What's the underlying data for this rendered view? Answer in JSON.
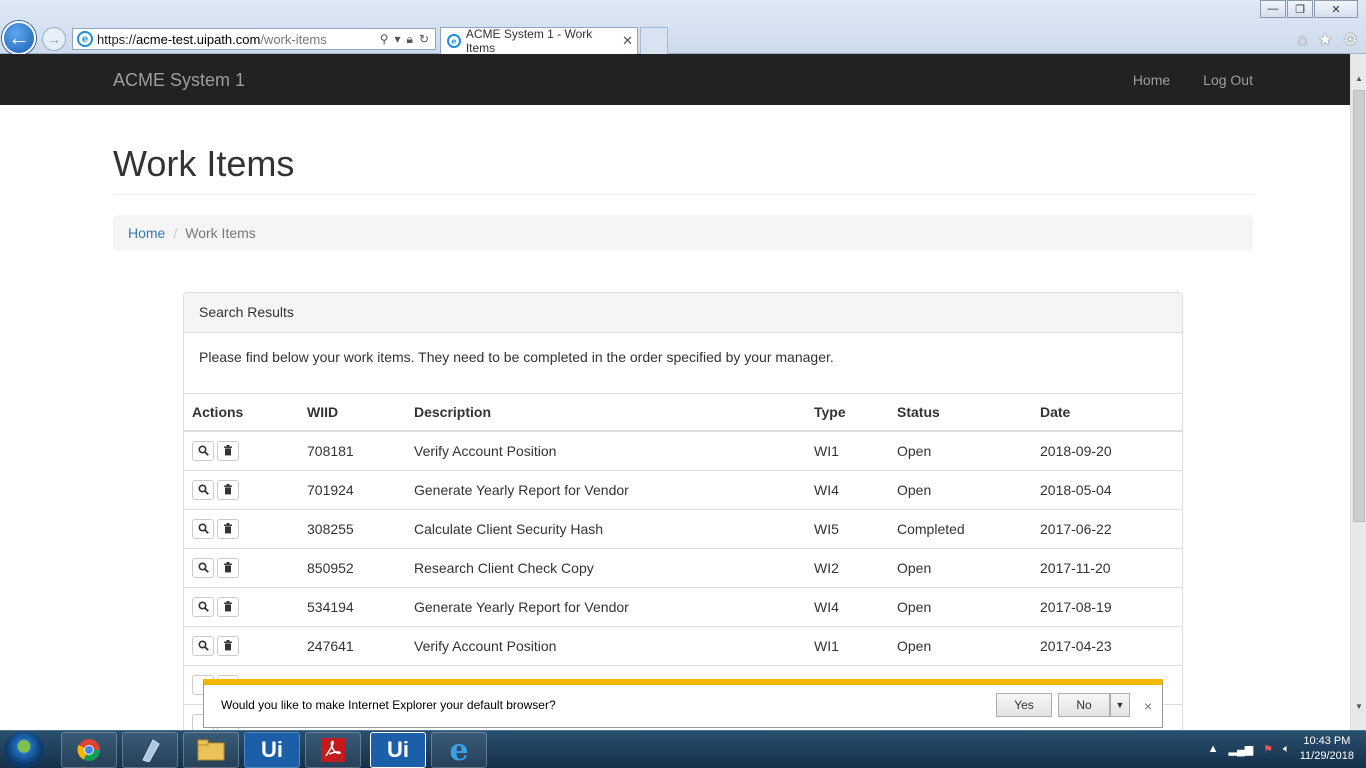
{
  "browser": {
    "url_prefix": "https://",
    "url_host": "acme-test.uipath.com",
    "url_path": "/work-items",
    "tab_title": "ACME System 1 - Work Items",
    "tab_close": "✕",
    "win_minimize": "—",
    "win_restore": "❐",
    "win_close": "✕"
  },
  "navbar": {
    "brand": "ACME System 1",
    "links": [
      "Home",
      "Log Out"
    ]
  },
  "page": {
    "title": "Work Items",
    "breadcrumb": [
      "Home",
      "Work Items"
    ],
    "breadcrumb_sep": "/"
  },
  "panel": {
    "heading": "Search Results",
    "body": "Please find below your work items. They need to be completed in the order specified by your manager.",
    "columns": [
      "Actions",
      "WIID",
      "Description",
      "Type",
      "Status",
      "Date"
    ],
    "rows": [
      {
        "wiid": "708181",
        "description": "Verify Account Position",
        "type": "WI1",
        "status": "Open",
        "date": "2018-09-20"
      },
      {
        "wiid": "701924",
        "description": "Generate Yearly Report for Vendor",
        "type": "WI4",
        "status": "Open",
        "date": "2018-05-04"
      },
      {
        "wiid": "308255",
        "description": "Calculate Client Security Hash",
        "type": "WI5",
        "status": "Completed",
        "date": "2017-06-22"
      },
      {
        "wiid": "850952",
        "description": "Research Client Check Copy",
        "type": "WI2",
        "status": "Open",
        "date": "2017-11-20"
      },
      {
        "wiid": "534194",
        "description": "Generate Yearly Report for Vendor",
        "type": "WI4",
        "status": "Open",
        "date": "2017-08-19"
      },
      {
        "wiid": "247641",
        "description": "Verify Account Position",
        "type": "WI1",
        "status": "Open",
        "date": "2017-04-23"
      }
    ]
  },
  "notification": {
    "text": "Would you like to make Internet Explorer your default browser?",
    "yes": "Yes",
    "no": "No",
    "close": "×"
  },
  "taskbar": {
    "time": "10:43 PM",
    "date": "11/29/2018"
  },
  "icons": [
    "back-arrow-icon",
    "forward-arrow-icon",
    "search-icon",
    "lock-icon",
    "refresh-icon",
    "home-icon",
    "star-icon",
    "gear-icon",
    "magnifier-icon",
    "trash-icon",
    "ie-icon",
    "chrome-icon",
    "pdf-icon",
    "uipath-icon",
    "folder-icon"
  ],
  "colors": {
    "navbar_bg": "#222222",
    "link": "#337ab7",
    "notification_accent": "#f5b800"
  }
}
